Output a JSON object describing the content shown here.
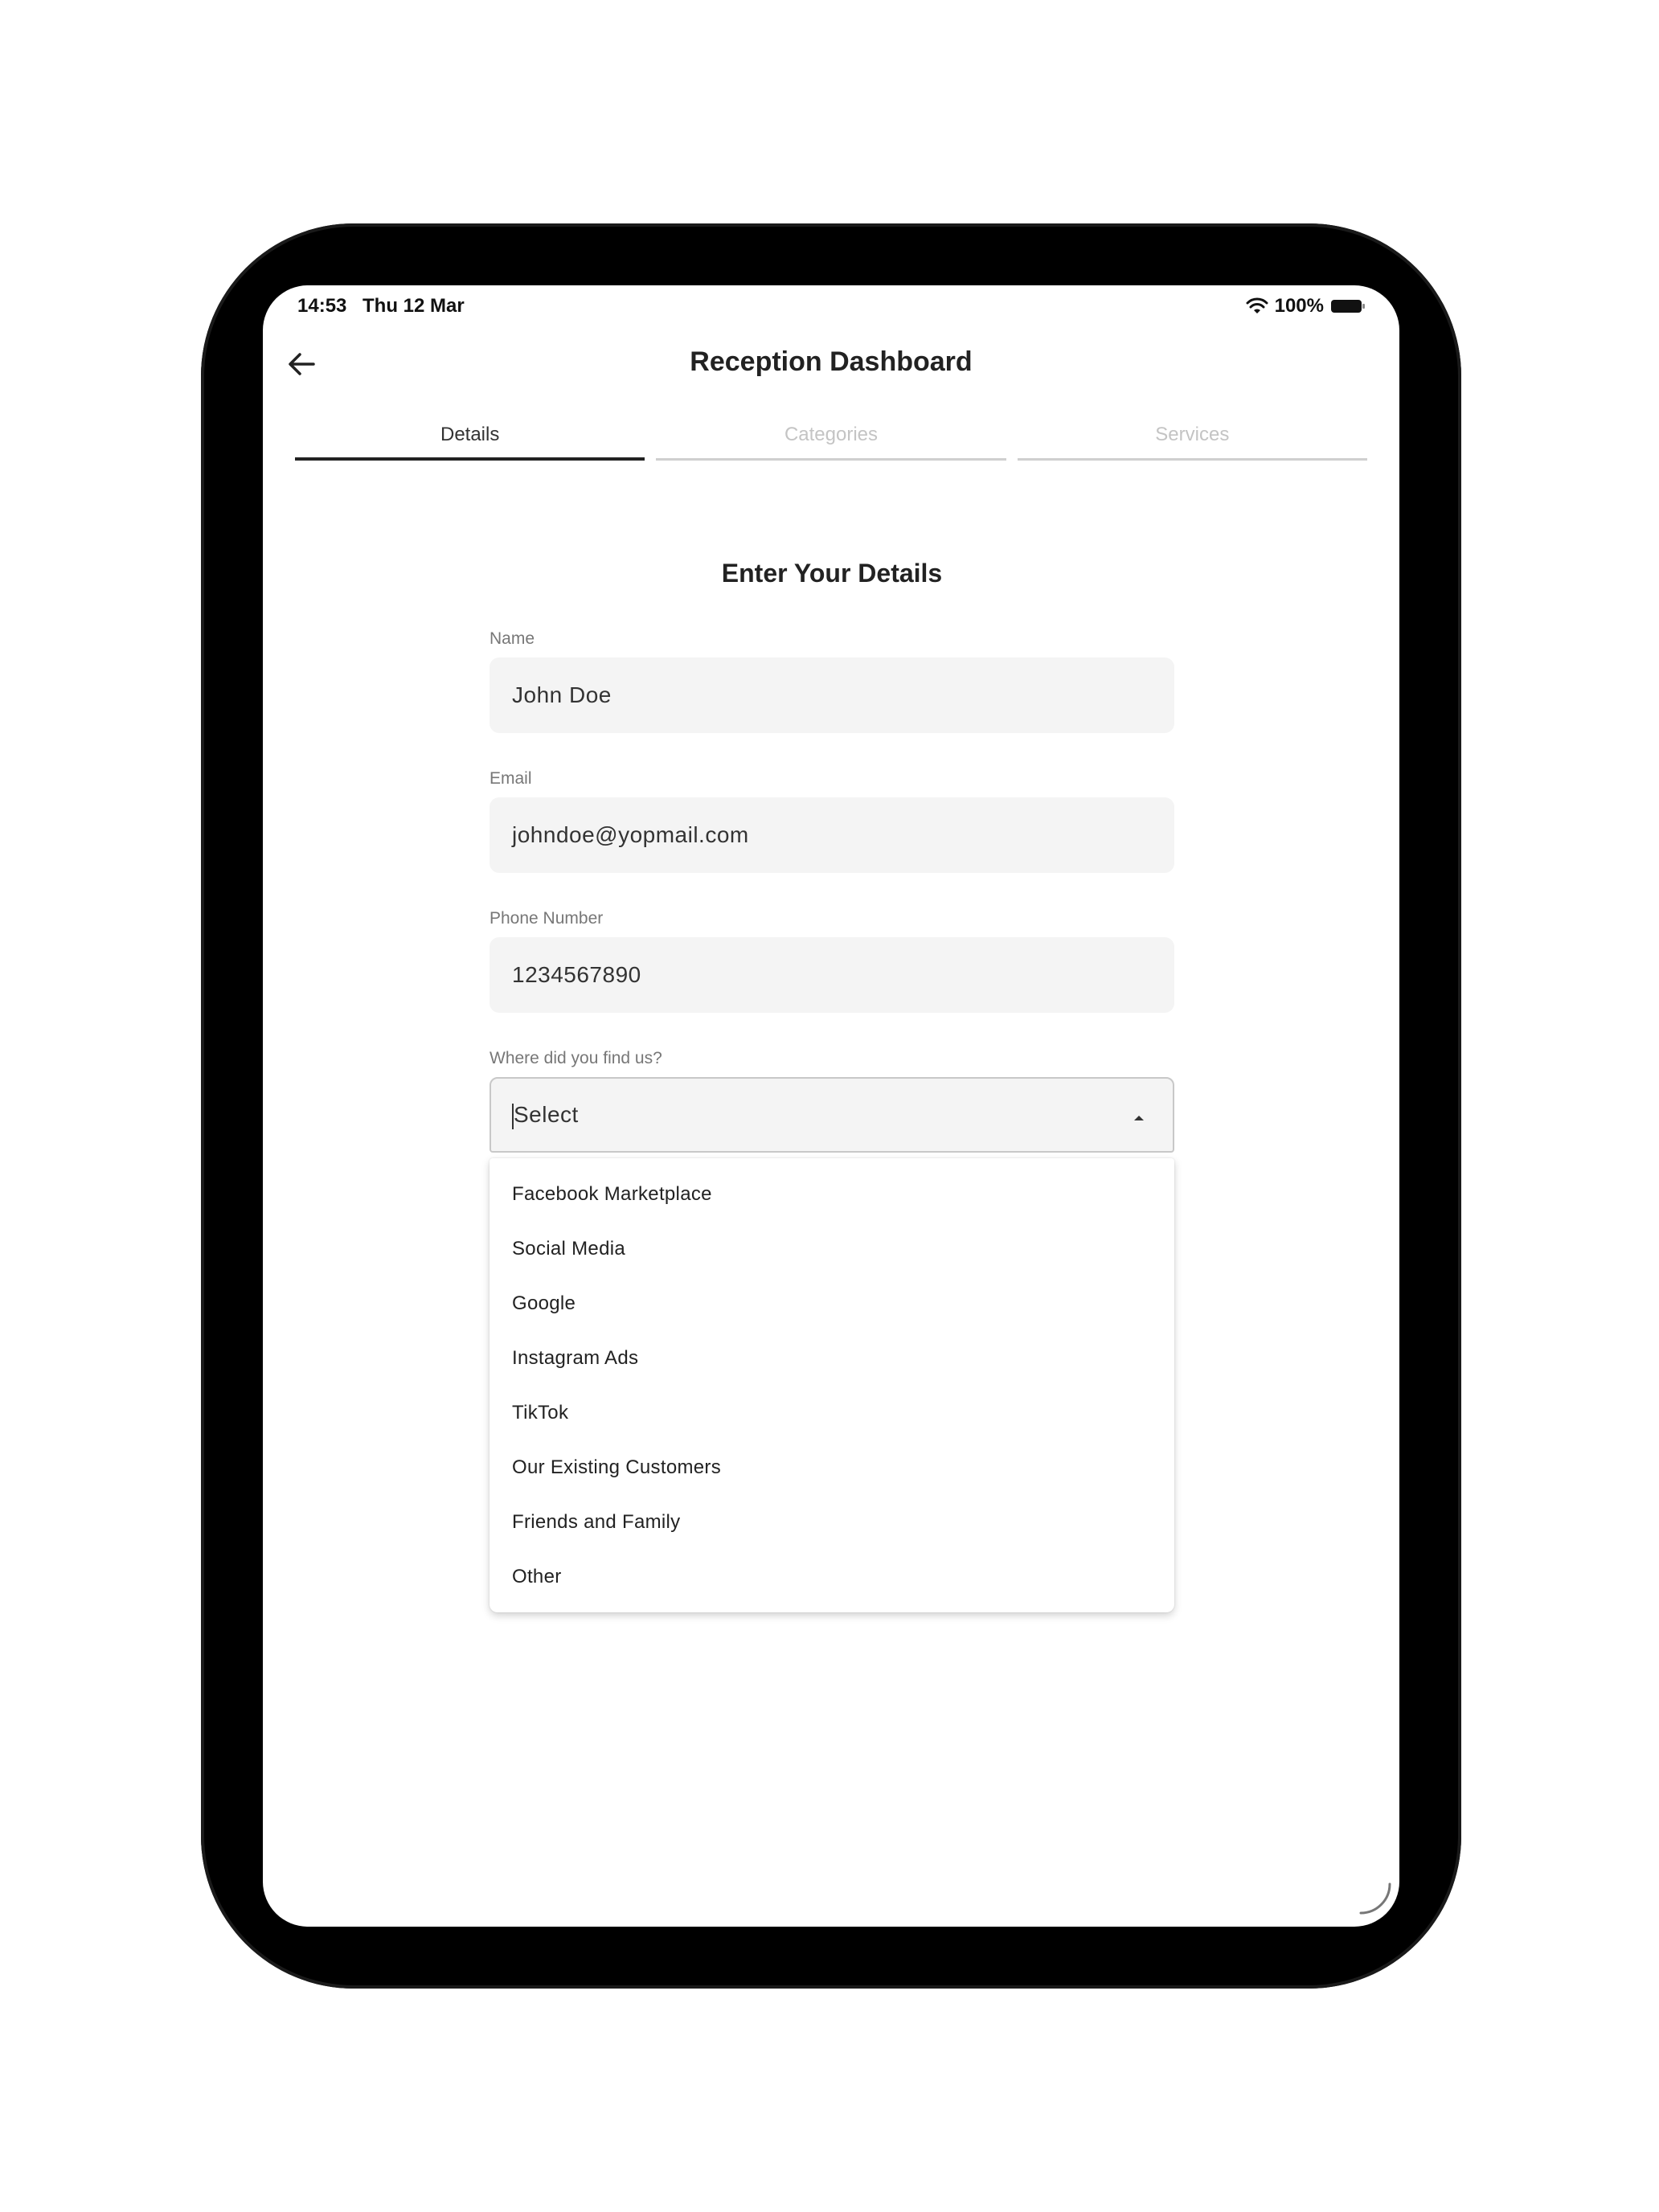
{
  "status_bar": {
    "time": "14:53",
    "date": "Thu 12 Mar",
    "battery": "100%"
  },
  "header": {
    "title": "Reception Dashboard",
    "back_icon": "arrow-left-icon"
  },
  "tabs": [
    {
      "label": "Details",
      "active": true
    },
    {
      "label": "Categories",
      "active": false
    },
    {
      "label": "Services",
      "active": false
    }
  ],
  "form": {
    "title": "Enter Your Details",
    "name": {
      "label": "Name",
      "value": "John Doe"
    },
    "email": {
      "label": "Email",
      "value": "johndoe@yopmail.com"
    },
    "phone": {
      "label": "Phone Number",
      "value": "1234567890"
    },
    "source": {
      "label": "Where did you find us?",
      "value": "Select",
      "options": [
        "Facebook Marketplace",
        "Social Media",
        "Google",
        "Instagram Ads",
        "TikTok",
        "Our Existing Customers",
        "Friends and Family",
        "Other"
      ]
    }
  },
  "colors": {
    "device_frame": "#000000",
    "field_background": "#f4f4f4",
    "active_tab": "#222222",
    "inactive_tab": "#c4c4c4"
  }
}
